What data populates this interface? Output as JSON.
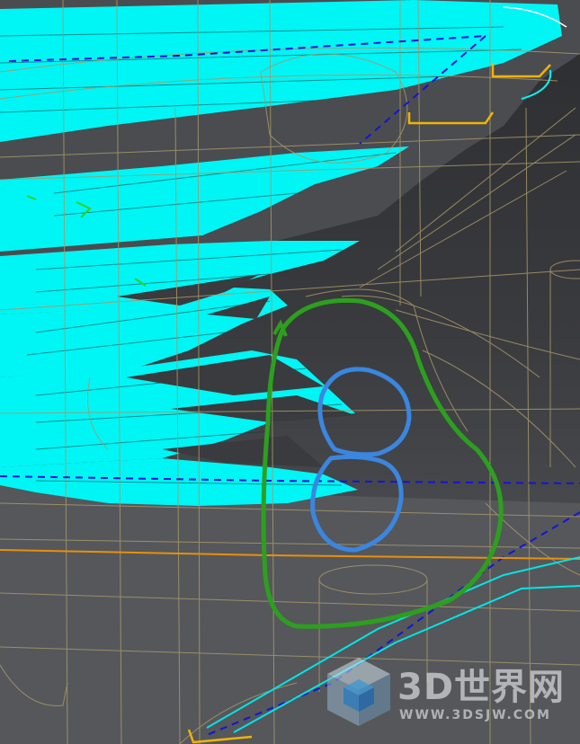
{
  "viewport": {
    "background": "#3a3b3e",
    "colors": {
      "toolpath": "#00f5f5",
      "wireframe": "#a89868",
      "boundary_dashed": "#1414d8",
      "markup_green": "#2ca01e",
      "markup_blue": "#3a86e0",
      "edge_orange": "#e8900a",
      "edge_yellow": "#f0b400"
    },
    "markup": {
      "outer_loop": "green-freehand-loop",
      "inner_mark": "blue-figure-eight"
    }
  },
  "watermark": {
    "icon": "3d-cube-logo-icon",
    "title": "3D世界网",
    "url": "WWW.3DSJW.COM"
  }
}
